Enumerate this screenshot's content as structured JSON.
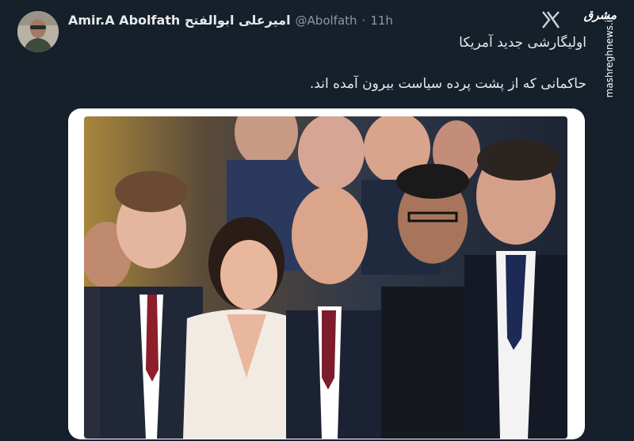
{
  "tweet": {
    "display_name": "Amir.A Abolfath امیرعلی ابوالفتح",
    "handle": "@Abolfath",
    "separator": "·",
    "time": "11h",
    "text_line_1": "اولیگارشی جدید آمریکا",
    "text_line_2": "حاکمانی که از پشت پرده سیاست بیرون آمده اند."
  },
  "watermark": {
    "logo_text": "مشرق",
    "url": "mashreghnews.ir"
  },
  "icons": {
    "platform": "x-logo-icon",
    "avatar": "user-avatar"
  },
  "colors": {
    "background": "#15202b",
    "text": "#e7e9ea",
    "muted": "#8b98a5"
  }
}
